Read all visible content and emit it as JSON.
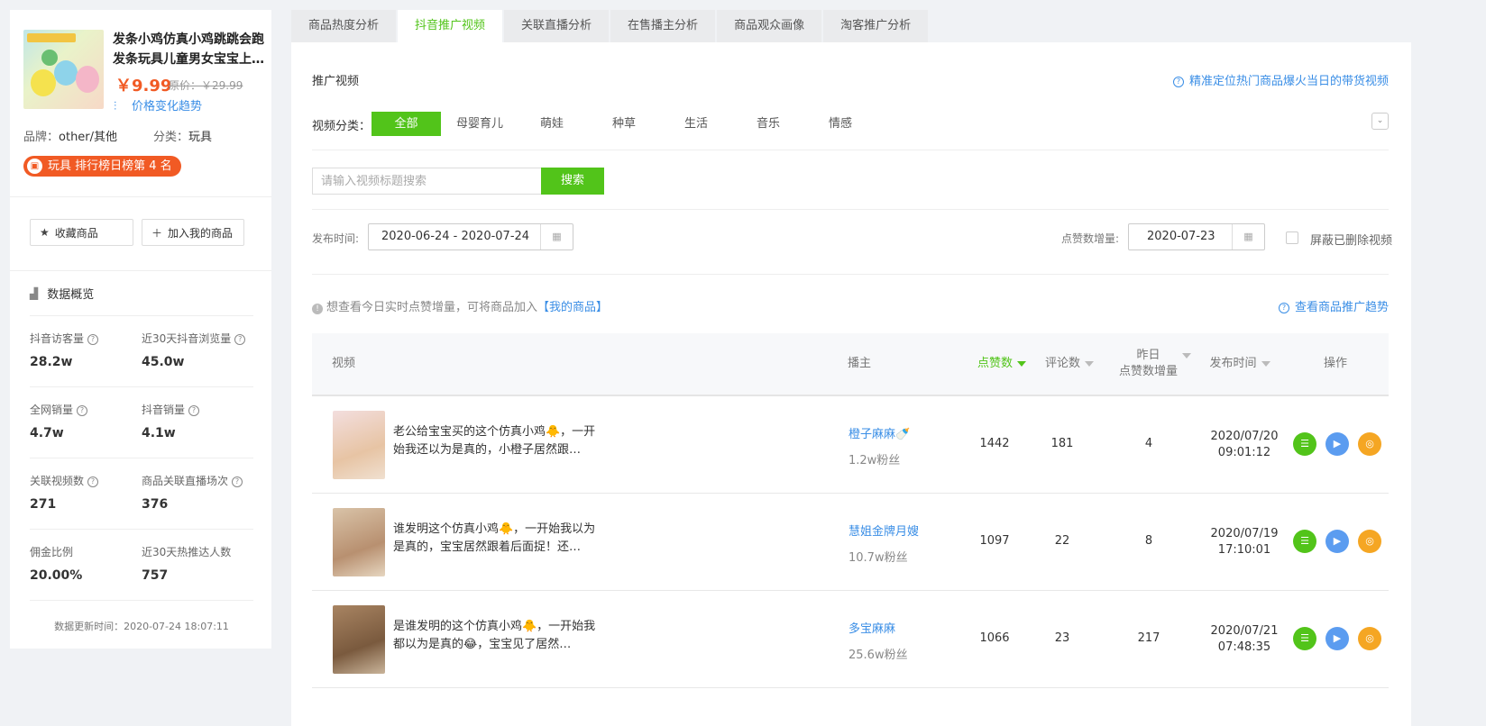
{
  "product": {
    "title": "发条小鸡仿真小鸡跳跳会跑发条玩具儿童男女宝宝上…",
    "price": "￥9.99",
    "original_price": "原价：￥29.99",
    "price_trend_label": "价格变化趋势",
    "brand_label": "品牌：",
    "brand_value": "other/其他",
    "category_label": "分类：",
    "category_value": "玩具",
    "rank_badge": "玩具 排行榜日榜第 4 名"
  },
  "actions": {
    "favorite": "收藏商品",
    "add_mine": "加入我的商品"
  },
  "overview": {
    "title": "数据概览",
    "stats": [
      {
        "label": "抖音访客量",
        "value": "28.2w",
        "help": true
      },
      {
        "label": "近30天抖音浏览量",
        "value": "45.0w",
        "help": true
      },
      {
        "label": "全网销量",
        "value": "4.7w",
        "help": true
      },
      {
        "label": "抖音销量",
        "value": "4.1w",
        "help": true
      },
      {
        "label": "关联视频数",
        "value": "271",
        "help": true
      },
      {
        "label": "商品关联直播场次",
        "value": "376",
        "help": true
      },
      {
        "label": "佣金比例",
        "value": "20.00%",
        "help": false
      },
      {
        "label": "近30天热推达人数",
        "value": "757",
        "help": false
      }
    ],
    "update_time": "数据更新时间：2020-07-24 18:07:11"
  },
  "tabs": [
    "商品热度分析",
    "抖音推广视频",
    "关联直播分析",
    "在售播主分析",
    "商品观众画像",
    "淘客推广分析"
  ],
  "active_tab": 1,
  "section": {
    "title": "推广视频",
    "tip": "精准定位热门商品爆火当日的带货视频",
    "category_label": "视频分类：",
    "categories": [
      "全部",
      "母婴育儿",
      "萌娃",
      "种草",
      "生活",
      "音乐",
      "情感"
    ],
    "search_placeholder": "请输入视频标题搜索",
    "search_button": "搜索",
    "publish_label": "发布时间:",
    "publish_range": "2020-06-24 - 2020-07-24",
    "likes_inc_label": "点赞数增量:",
    "likes_inc_date": "2020-07-23",
    "hide_deleted": "屏蔽已删除视频",
    "info_text": "想查看今日实时点赞增量，可将商品加入",
    "info_link": "【我的商品】",
    "trend_link": "查看商品推广趋势"
  },
  "table": {
    "headers": {
      "video": "视频",
      "anchor": "播主",
      "likes": "点赞数",
      "comments": "评论数",
      "yesterday_line1": "昨日",
      "yesterday_line2": "点赞数增量",
      "publish_time": "发布时间",
      "ops": "操作"
    },
    "rows": [
      {
        "title": "老公给宝宝买的这个仿真小鸡🐥，一开始我还以为是真的，小橙子居然跟…",
        "anchor": "橙子麻麻🍼",
        "fans": "1.2w粉丝",
        "likes": "1442",
        "comments": "181",
        "yesterday": "4",
        "date": "2020/07/20",
        "time": "09:01:12",
        "thumb_color": "#e9c9c9"
      },
      {
        "title": "谁发明这个仿真小鸡🐥，一开始我以为是真的，宝宝居然跟着后面捉！还…",
        "anchor": "慧姐金牌月嫂",
        "fans": "10.7w粉丝",
        "likes": "1097",
        "comments": "22",
        "yesterday": "8",
        "date": "2020/07/19",
        "time": "17:10:01",
        "thumb_color": "#c9a98a"
      },
      {
        "title": "是谁发明的这个仿真小鸡🐥，一开始我都以为是真的😂，宝宝见了居然…",
        "anchor": "多宝麻麻",
        "fans": "25.6w粉丝",
        "likes": "1066",
        "comments": "23",
        "yesterday": "217",
        "date": "2020/07/21",
        "time": "07:48:35",
        "thumb_color": "#9c7a5a"
      }
    ]
  },
  "colors": {
    "accent": "#52c41a",
    "link": "#3a8ee6",
    "price": "#f15a24"
  }
}
